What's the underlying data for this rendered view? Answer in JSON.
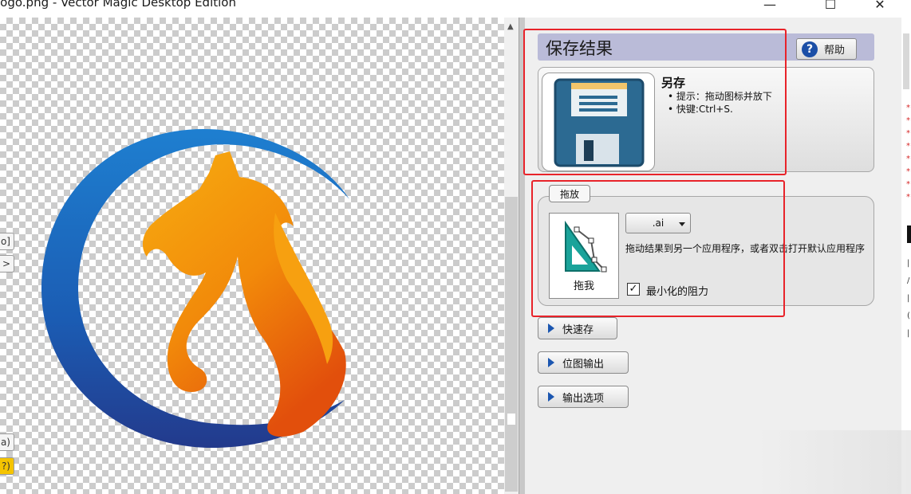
{
  "window": {
    "title": "logo.png - Vector Magic Desktop Edition",
    "minimize_icon": "—",
    "maximize_icon": "☐",
    "close_icon": "✕"
  },
  "left_tools": [
    "[o]",
    ">",
    "a)",
    "?)"
  ],
  "panel": {
    "header_title": "保存结果",
    "help_label": "帮助",
    "save_as": {
      "title": "另存",
      "hints": [
        "提示：拖动图标并放下",
        "快键:Ctrl+S."
      ]
    },
    "drag_drop": {
      "legend": "拖放",
      "drag_label": "拖我",
      "format_value": ".ai",
      "description": "拖动结果到另一个应用程序，或者双击打开默认应用程序",
      "checkbox_checked": true,
      "checkbox_label": "最小化的阻力"
    },
    "buttons": [
      {
        "label": "快速存"
      },
      {
        "label": "位图输出"
      },
      {
        "label": "输出选项"
      }
    ]
  },
  "colors": {
    "header_bg": "#babbd8",
    "highlight_red": "#e8232a",
    "ring_blue": "#1b56b0",
    "flame_orange": "#f39a0a"
  }
}
